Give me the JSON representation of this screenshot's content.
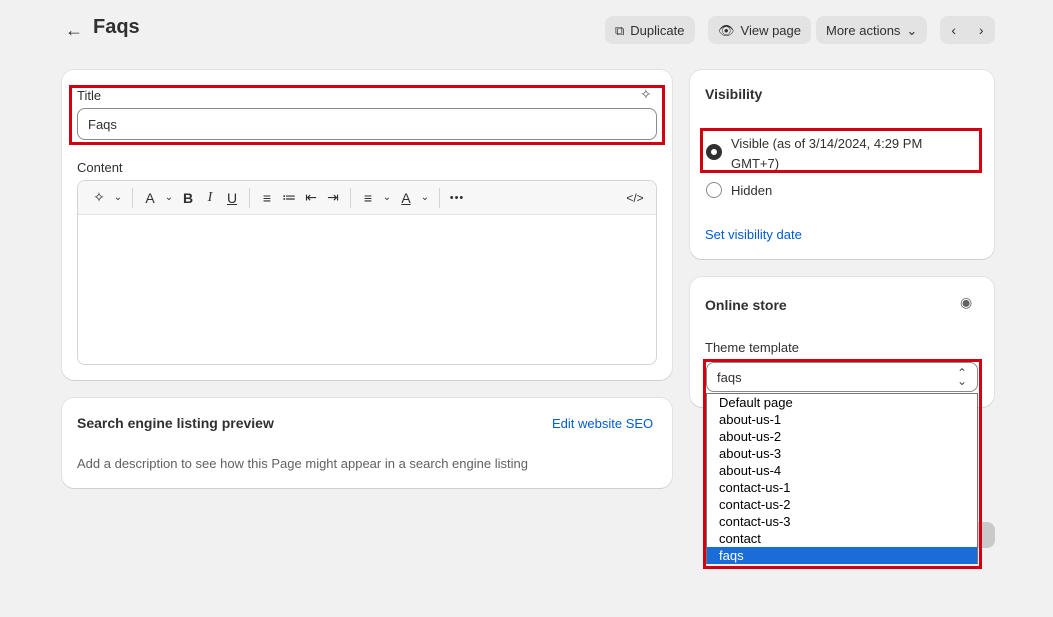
{
  "header": {
    "back_icon": "←",
    "title": "Faqs",
    "duplicate_label": "Duplicate",
    "view_page_label": "View page",
    "more_actions_label": "More actions",
    "prev_icon": "‹",
    "next_icon": "›"
  },
  "main": {
    "title_label": "Title",
    "title_value": "Faqs",
    "content_label": "Content",
    "toolbar": {
      "magic_icon": "✧",
      "font_icon": "A",
      "bold_icon": "B",
      "italic_icon": "I",
      "underline_icon": "U",
      "bullet_icon": "≡",
      "numbered_icon": "≔",
      "outdent_icon": "⇤",
      "indent_icon": "⇥",
      "align_icon": "≡",
      "color_icon": "A",
      "more_icon": "•••",
      "code_icon": "</>"
    }
  },
  "seo": {
    "title": "Search engine listing preview",
    "edit_link": "Edit website SEO",
    "description": "Add a description to see how this Page might appear in a search engine listing"
  },
  "visibility": {
    "title": "Visibility",
    "visible_label_line1": "Visible (as of 3/14/2024, 4:29 PM",
    "visible_label_line2": "GMT+7)",
    "hidden_label": "Hidden",
    "set_date_link": "Set visibility date"
  },
  "online_store": {
    "title": "Online store",
    "eye_icon": "◉",
    "theme_template_label": "Theme template",
    "selected": "faqs",
    "options": [
      "Default page",
      "about-us-1",
      "about-us-2",
      "about-us-3",
      "about-us-4",
      "contact-us-1",
      "contact-us-2",
      "contact-us-3",
      "contact",
      "faqs"
    ]
  },
  "colors": {
    "highlight": "#d4000f",
    "link": "#005bd3",
    "selected_option": "#1a6cd6"
  }
}
